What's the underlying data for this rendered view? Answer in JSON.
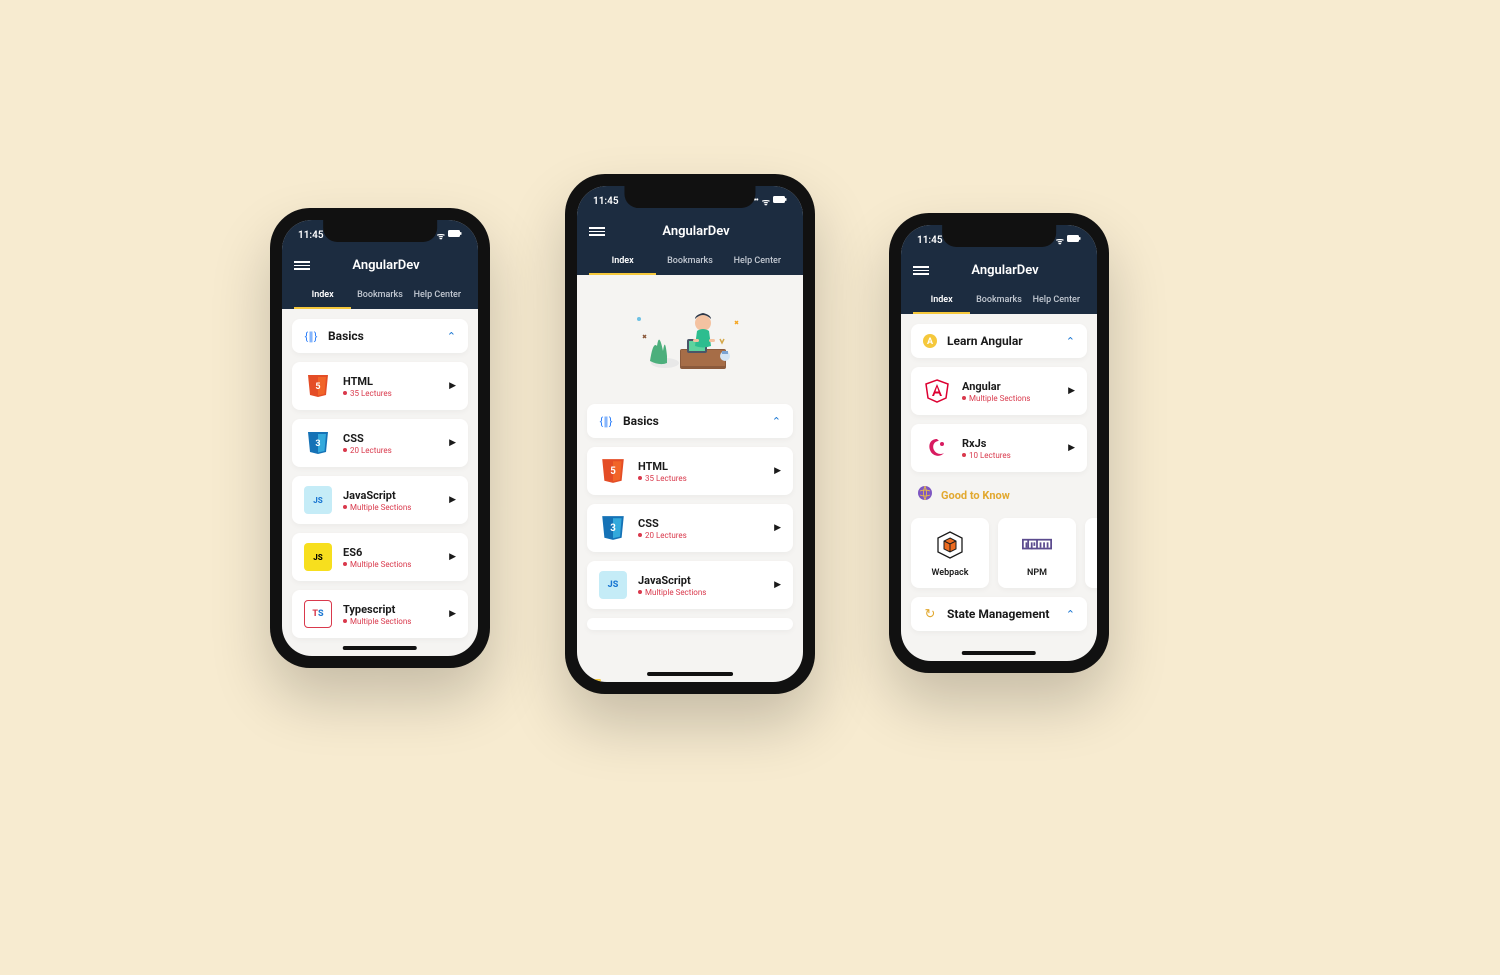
{
  "common": {
    "time": "11:45",
    "app_title": "AngularDev",
    "tabs": {
      "index": "Index",
      "bookmarks": "Bookmarks",
      "help": "Help Center"
    }
  },
  "screen1": {
    "section": {
      "title": "Basics"
    },
    "courses": [
      {
        "title": "HTML",
        "sub": "35 Lectures"
      },
      {
        "title": "CSS",
        "sub": "20 Lectures"
      },
      {
        "title": "JavaScript",
        "sub": "Multiple Sections"
      },
      {
        "title": "ES6",
        "sub": "Multiple Sections"
      },
      {
        "title": "Typescript",
        "sub": "Multiple Sections"
      }
    ]
  },
  "screen2": {
    "section": {
      "title": "Basics"
    },
    "courses": [
      {
        "title": "HTML",
        "sub": "35 Lectures"
      },
      {
        "title": "CSS",
        "sub": "20 Lectures"
      },
      {
        "title": "JavaScript",
        "sub": "Multiple Sections"
      }
    ]
  },
  "screen3": {
    "section1": {
      "title": "Learn Angular"
    },
    "courses1": [
      {
        "title": "Angular",
        "sub": "Multiple Sections"
      },
      {
        "title": "RxJs",
        "sub": "10 Lectures"
      }
    ],
    "gtk": {
      "title": "Good to Know",
      "items": [
        {
          "label": "Webpack"
        },
        {
          "label": "NPM"
        }
      ]
    },
    "section2": {
      "title": "State Management"
    }
  }
}
